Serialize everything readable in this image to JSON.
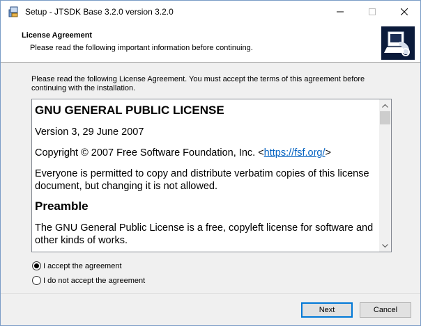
{
  "window": {
    "title": "Setup - JTSDK Base 3.2.0 version 3.2.0"
  },
  "header": {
    "title": "License Agreement",
    "subtitle": "Please read the following important information before continuing."
  },
  "instructions": "Please read the following License Agreement. You must accept the terms of this agreement before continuing with the installation.",
  "license": {
    "heading": "GNU GENERAL PUBLIC LICENSE",
    "version": "Version 3, 29 June 2007",
    "copyright_prefix": "Copyright © 2007 Free Software Foundation, Inc. <",
    "copyright_link": "https://fsf.org/",
    "copyright_suffix": ">",
    "para1": "Everyone is permitted to copy and distribute verbatim copies of this license document, but changing it is not allowed.",
    "preamble_heading": "Preamble",
    "para2": "The GNU General Public License is a free, copyleft license for software and other kinds of works."
  },
  "options": {
    "accept": "I accept the agreement",
    "decline": "I do not accept the agreement",
    "selected": "accept"
  },
  "buttons": {
    "next": "Next",
    "cancel": "Cancel"
  }
}
